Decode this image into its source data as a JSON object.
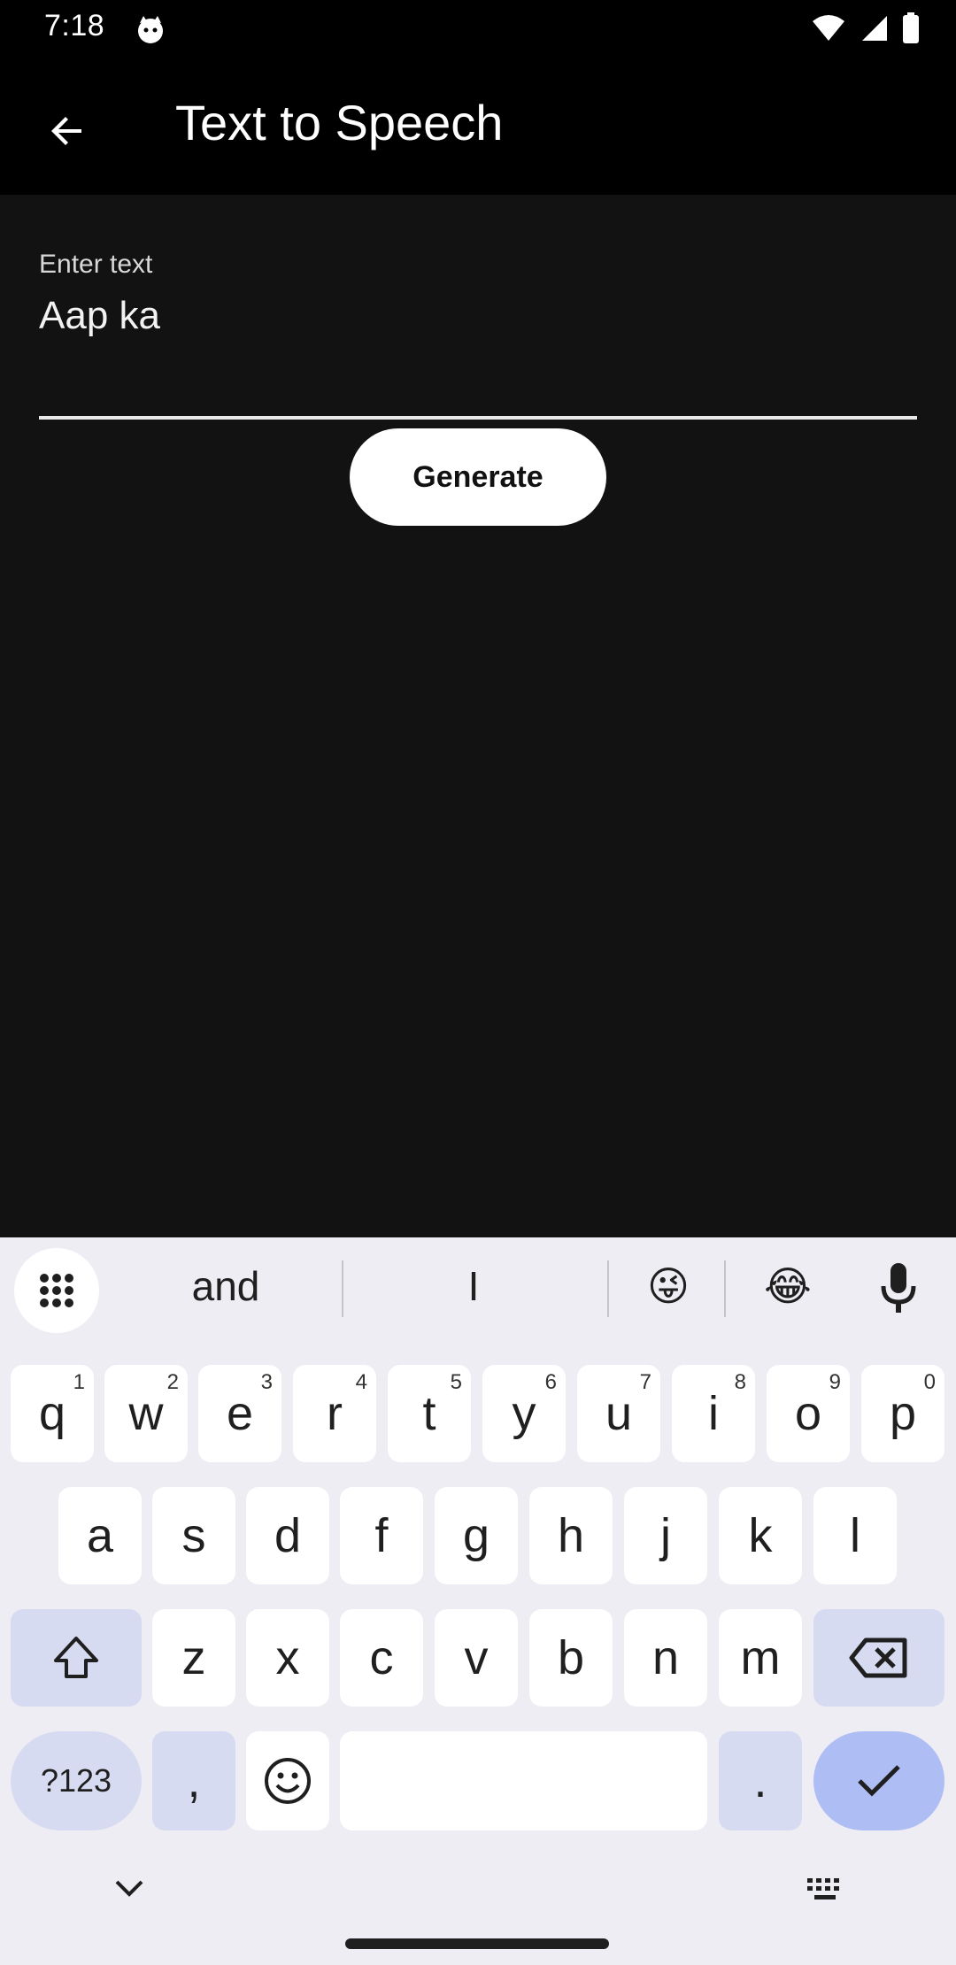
{
  "status_bar": {
    "time": "7:18"
  },
  "app_bar": {
    "title": "Text to Speech"
  },
  "input": {
    "label": "Enter text",
    "value": "Aap ka"
  },
  "generate_button": "Generate",
  "keyboard": {
    "suggestions": [
      "and",
      "I",
      "😜",
      "😂"
    ],
    "row1": [
      {
        "k": "q",
        "n": "1"
      },
      {
        "k": "w",
        "n": "2"
      },
      {
        "k": "e",
        "n": "3"
      },
      {
        "k": "r",
        "n": "4"
      },
      {
        "k": "t",
        "n": "5"
      },
      {
        "k": "y",
        "n": "6"
      },
      {
        "k": "u",
        "n": "7"
      },
      {
        "k": "i",
        "n": "8"
      },
      {
        "k": "o",
        "n": "9"
      },
      {
        "k": "p",
        "n": "0"
      }
    ],
    "row2": [
      "a",
      "s",
      "d",
      "f",
      "g",
      "h",
      "j",
      "k",
      "l"
    ],
    "row3": [
      "z",
      "x",
      "c",
      "v",
      "b",
      "n",
      "m"
    ],
    "symbols_key": "?123",
    "comma_key": ",",
    "period_key": "."
  },
  "colors": {
    "app_bg": "#000000",
    "content_bg": "#121212",
    "keyboard_bg": "#eeedf4",
    "function_key": "#d7dbf1",
    "enter_key": "#aebdf4"
  }
}
